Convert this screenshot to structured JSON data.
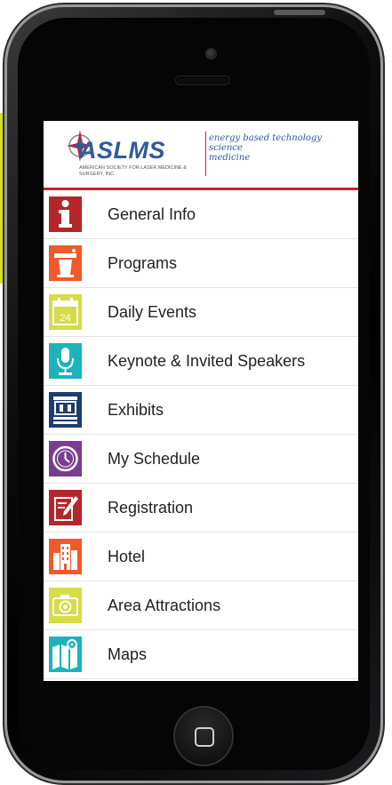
{
  "header": {
    "logo_text": "ASLMS",
    "logo_subtitle": "American Society for Laser Medicine & Surgery, Inc.",
    "tagline": [
      "energy based technology",
      "science",
      "medicine"
    ]
  },
  "menu": {
    "items": [
      {
        "label": "General Info",
        "icon": "info-icon",
        "color": "#b5262b"
      },
      {
        "label": "Programs",
        "icon": "podium-icon",
        "color": "#ef5a2c"
      },
      {
        "label": "Daily Events",
        "icon": "calendar-icon",
        "color": "#d5dc48",
        "calendar_day": "24"
      },
      {
        "label": "Keynote & Invited Speakers",
        "icon": "microphone-icon",
        "color": "#1db3ba"
      },
      {
        "label": "Exhibits",
        "icon": "exhibit-booth-icon",
        "color": "#1d3d6d"
      },
      {
        "label": "My Schedule",
        "icon": "clock-icon",
        "color": "#7a3c8f"
      },
      {
        "label": "Registration",
        "icon": "pencil-form-icon",
        "color": "#b5262b"
      },
      {
        "label": "Hotel",
        "icon": "building-icon",
        "color": "#ef5a2c"
      },
      {
        "label": "Area Attractions",
        "icon": "camera-icon",
        "color": "#d5dc48"
      },
      {
        "label": "Maps",
        "icon": "map-icon",
        "color": "#1db3ba"
      }
    ]
  },
  "colors": {
    "header_rule": "#c8232c",
    "brand_blue": "#2f5b9b",
    "page_accent": "#d8df2a"
  }
}
